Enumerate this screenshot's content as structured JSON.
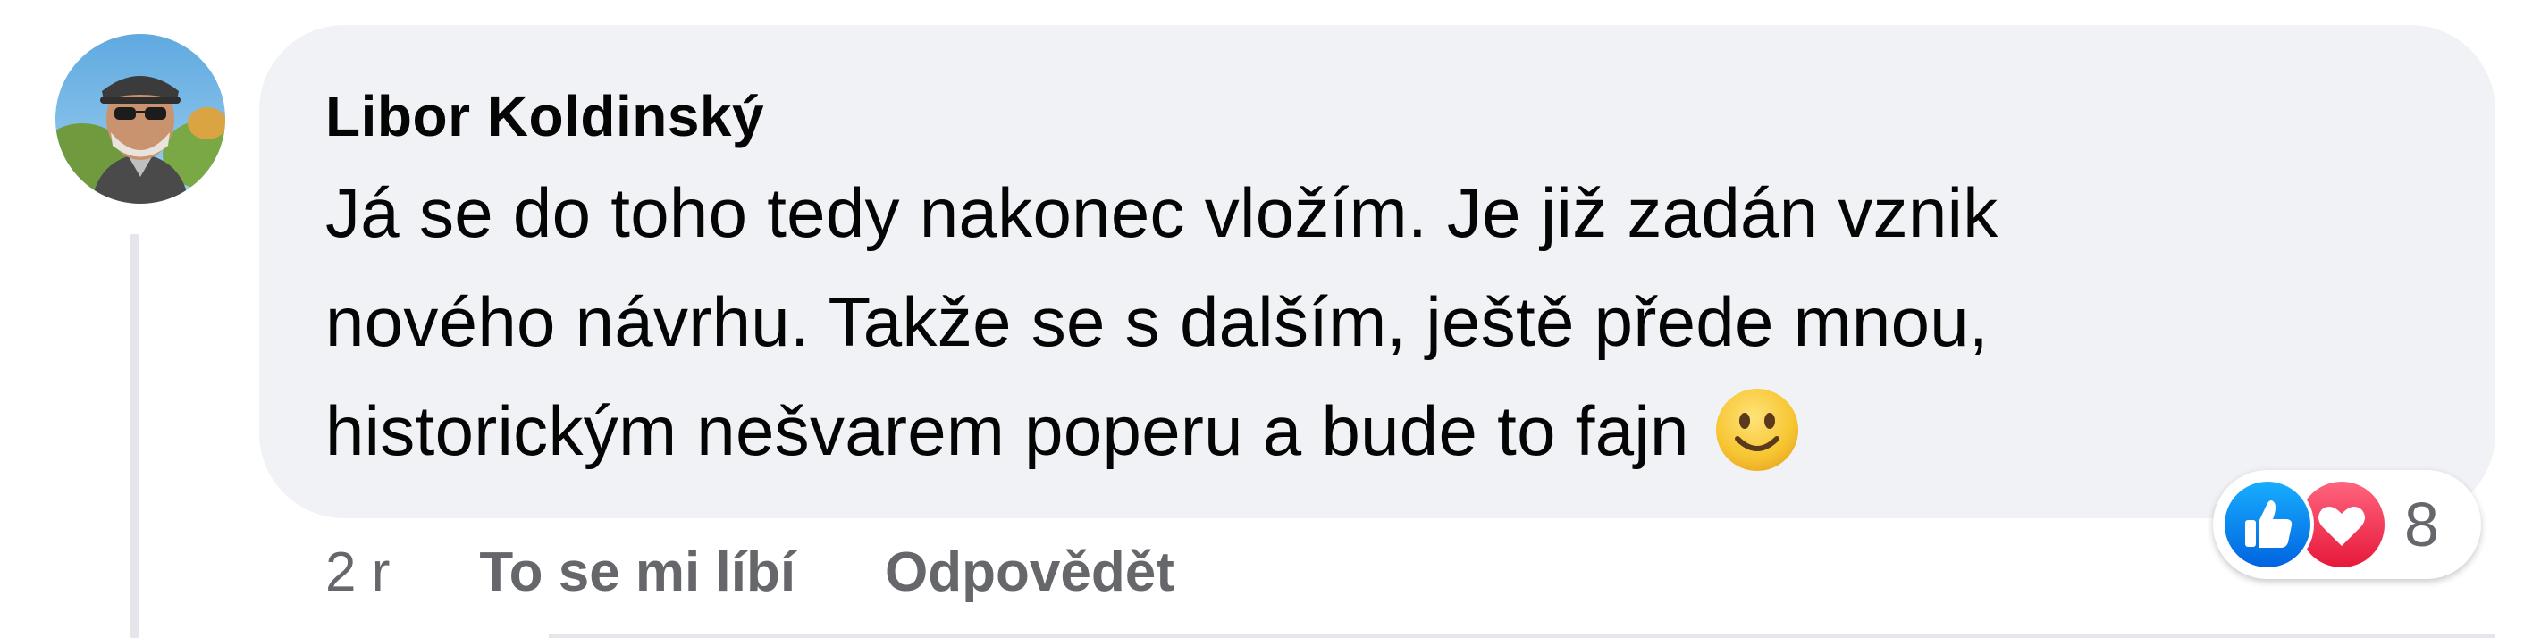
{
  "comment": {
    "author": "Libor Koldinský",
    "text_lines": [
      "Já se do toho tedy nakonec vložím. Je již zadán vznik",
      "nového návrhu. Takže se s dalším, ještě přede mnou,",
      "historickým nešvarem poperu a bude to fajn"
    ],
    "emoji_icon": "slightly-smiling-face-icon"
  },
  "actions": {
    "timestamp": "2 r",
    "like_label": "To se mi líbí",
    "reply_label": "Odpovědět"
  },
  "reactions": {
    "icons": [
      "like-icon",
      "love-icon"
    ],
    "count": "8"
  },
  "colors": {
    "bubble": "#f0f2f5",
    "text": "#050505",
    "secondary_text": "#65676b",
    "like_blue": "#1877f2",
    "love_red": "#f33e58",
    "thread_line": "#e4e6eb"
  }
}
